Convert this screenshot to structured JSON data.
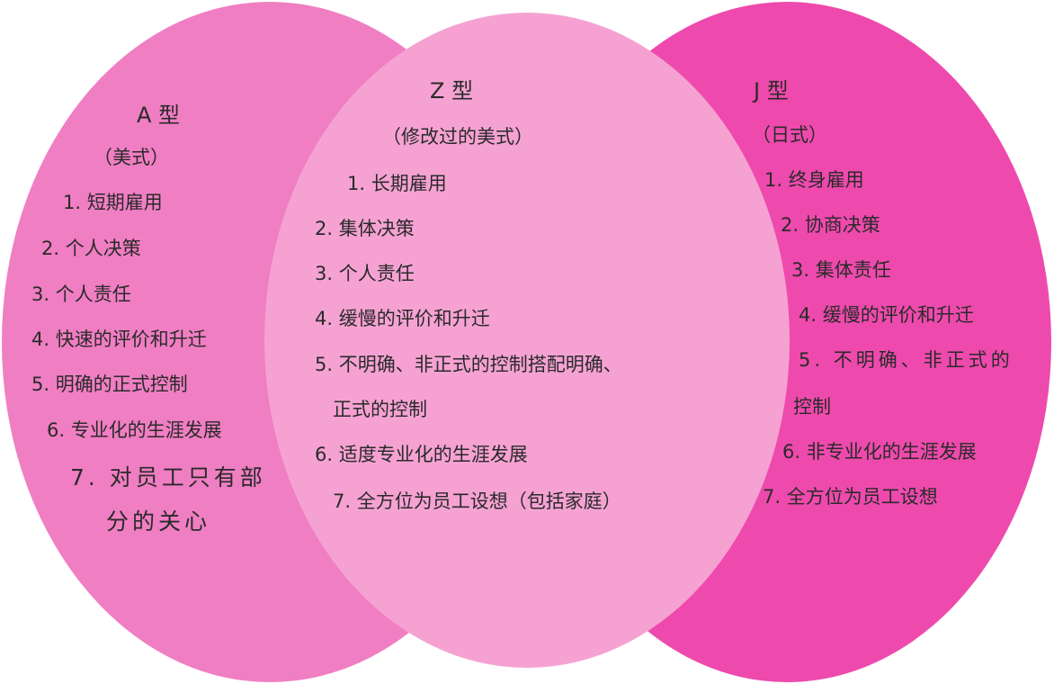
{
  "groups": {
    "a": {
      "title": "A 型",
      "subtitle": "（美式）",
      "color": "#F07EC3",
      "items": [
        [
          "1. 短期雇用"
        ],
        [
          "2. 个人决策"
        ],
        [
          "3. 个人责任"
        ],
        [
          "4. 快速的评价和升迁"
        ],
        [
          "5. 明确的正式控制"
        ],
        [
          "6. 专业化的生涯发展"
        ],
        [
          "7. 对员工只有部",
          "分的关心"
        ]
      ]
    },
    "z": {
      "title": "Z 型",
      "subtitle": "（修改过的美式）",
      "color": "#F5A2D3",
      "items": [
        [
          "1. 长期雇用"
        ],
        [
          "2. 集体决策"
        ],
        [
          "3. 个人责任"
        ],
        [
          "4. 缓慢的评价和升迁"
        ],
        [
          "5. 不明确、非正式的控制搭配明确、",
          "正式的控制"
        ],
        [
          "6. 适度专业化的生涯发展"
        ],
        [
          "7. 全方位为员工设想（包括家庭）"
        ]
      ]
    },
    "j": {
      "title": "J 型",
      "subtitle": "（日式）",
      "color": "#EE4AAD",
      "items": [
        [
          "1. 终身雇用"
        ],
        [
          "2. 协商决策"
        ],
        [
          "3. 集体责任"
        ],
        [
          "4. 缓慢的评价和升迁"
        ],
        [
          "5. 不明确、非正式的",
          "控制"
        ],
        [
          "6. 非专业化的生涯发展"
        ],
        [
          "7. 全方位为员工设想"
        ]
      ]
    }
  }
}
